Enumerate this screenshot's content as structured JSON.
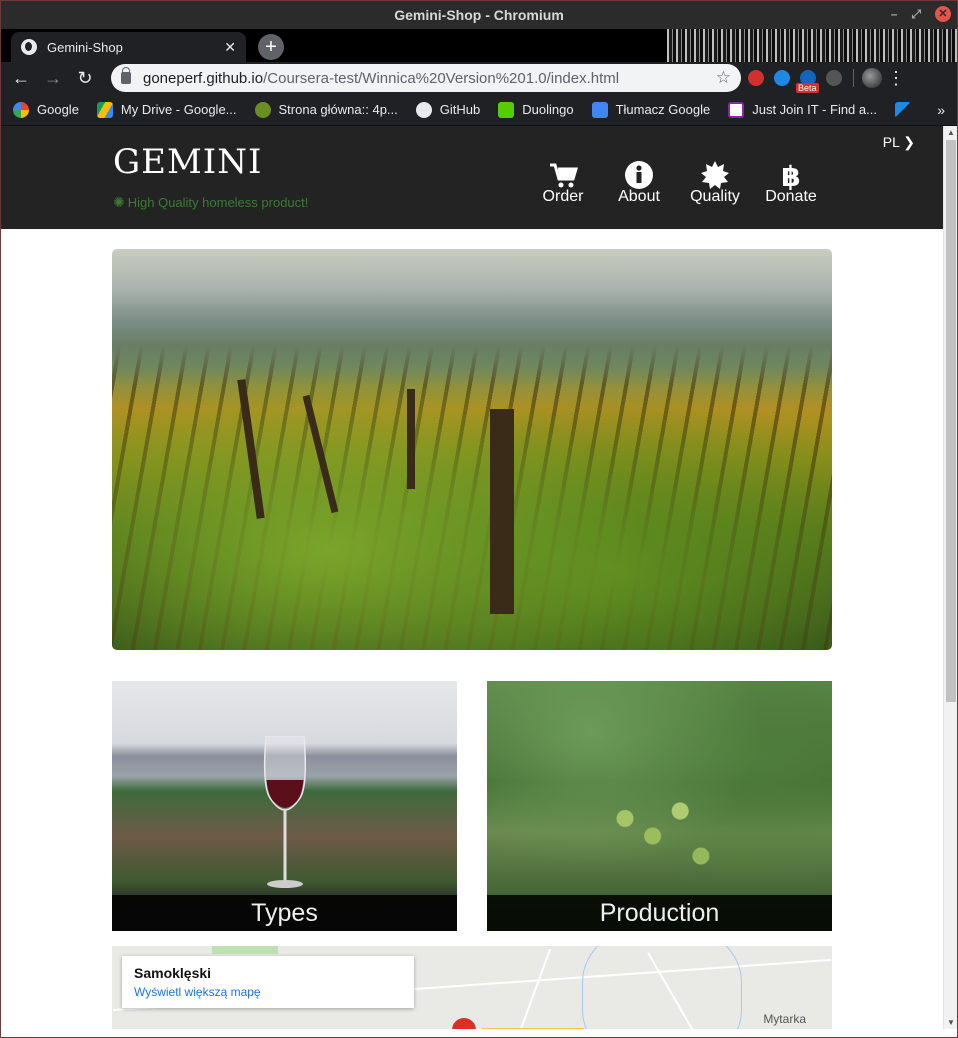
{
  "window": {
    "title": "Gemini-Shop - Chromium"
  },
  "tab": {
    "title": "Gemini-Shop",
    "favicon": "globe-icon"
  },
  "omnibox": {
    "host": "goneperf.github.io",
    "path": "/Coursera-test/Winnica%20Version%201.0/index.html"
  },
  "extensions": {
    "beta_badge": "Beta"
  },
  "bookmarks": [
    {
      "label": "Google",
      "icon": "google-icon"
    },
    {
      "label": "My Drive - Google...",
      "icon": "drive-icon"
    },
    {
      "label": "Strona główna:: 4p...",
      "icon": "4p-icon"
    },
    {
      "label": "GitHub",
      "icon": "github-icon"
    },
    {
      "label": "Duolingo",
      "icon": "duolingo-icon"
    },
    {
      "label": "Tłumacz Google",
      "icon": "translate-icon"
    },
    {
      "label": "Just Join IT - Find a...",
      "icon": "justjoinit-icon"
    }
  ],
  "site": {
    "brand": "GEMINI",
    "tagline": "High Quality homeless product!",
    "lang": "PL",
    "nav": [
      {
        "label": "Order",
        "icon": "cart-icon"
      },
      {
        "label": "About",
        "icon": "info-icon"
      },
      {
        "label": "Quality",
        "icon": "certificate-icon"
      },
      {
        "label": "Donate",
        "icon": "bitcoin-icon"
      }
    ],
    "cards": [
      {
        "label": "Types"
      },
      {
        "label": "Production"
      }
    ],
    "map": {
      "place": "Samoklęski",
      "link": "Wyświetl większą mapę",
      "town": "Mytarka"
    }
  },
  "colors": {
    "header_bg": "#232323",
    "tagline_green": "#3d7a36",
    "chrome_bg": "#202124"
  }
}
